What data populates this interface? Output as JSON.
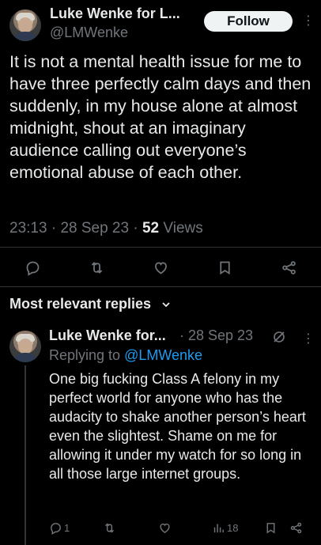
{
  "tweet": {
    "author_name": "Luke Wenke for L...",
    "author_handle": "@LMWenke",
    "follow_label": "Follow",
    "more_glyph": "⋮",
    "text": "It is not a mental health issue for me to have three perfectly calm days and then suddenly, in my house alone at almost midnight, shout at an imaginary audience calling out everyone’s emotional abuse of each other.",
    "time": "23:13",
    "date": "28 Sep 23",
    "views_count": "52",
    "views_label": "Views",
    "separator": "·"
  },
  "actions": {
    "icons": [
      "reply-icon",
      "retweet-icon",
      "like-icon",
      "bookmark-icon",
      "share-icon"
    ]
  },
  "replies_section": {
    "sort_label": "Most relevant replies"
  },
  "reply": {
    "author_name": "Luke Wenke for...",
    "date": "· 28 Sep 23",
    "more_glyph": "⋮",
    "replying_prefix": "Replying to",
    "replying_handle": "@LMWenke",
    "text": "One big fucking Class A felony in my perfect world for anyone who has the audacity to shake another person’s heart even the slightest. Shame on me for allowing it under my watch for so long in all those large internet groups.",
    "reply_count": "1",
    "views_count": "18"
  },
  "colors": {
    "background": "#000000",
    "text": "#e7e9ea",
    "secondary": "#71767b",
    "accent": "#1d9bf0",
    "divider": "#2f3336"
  }
}
